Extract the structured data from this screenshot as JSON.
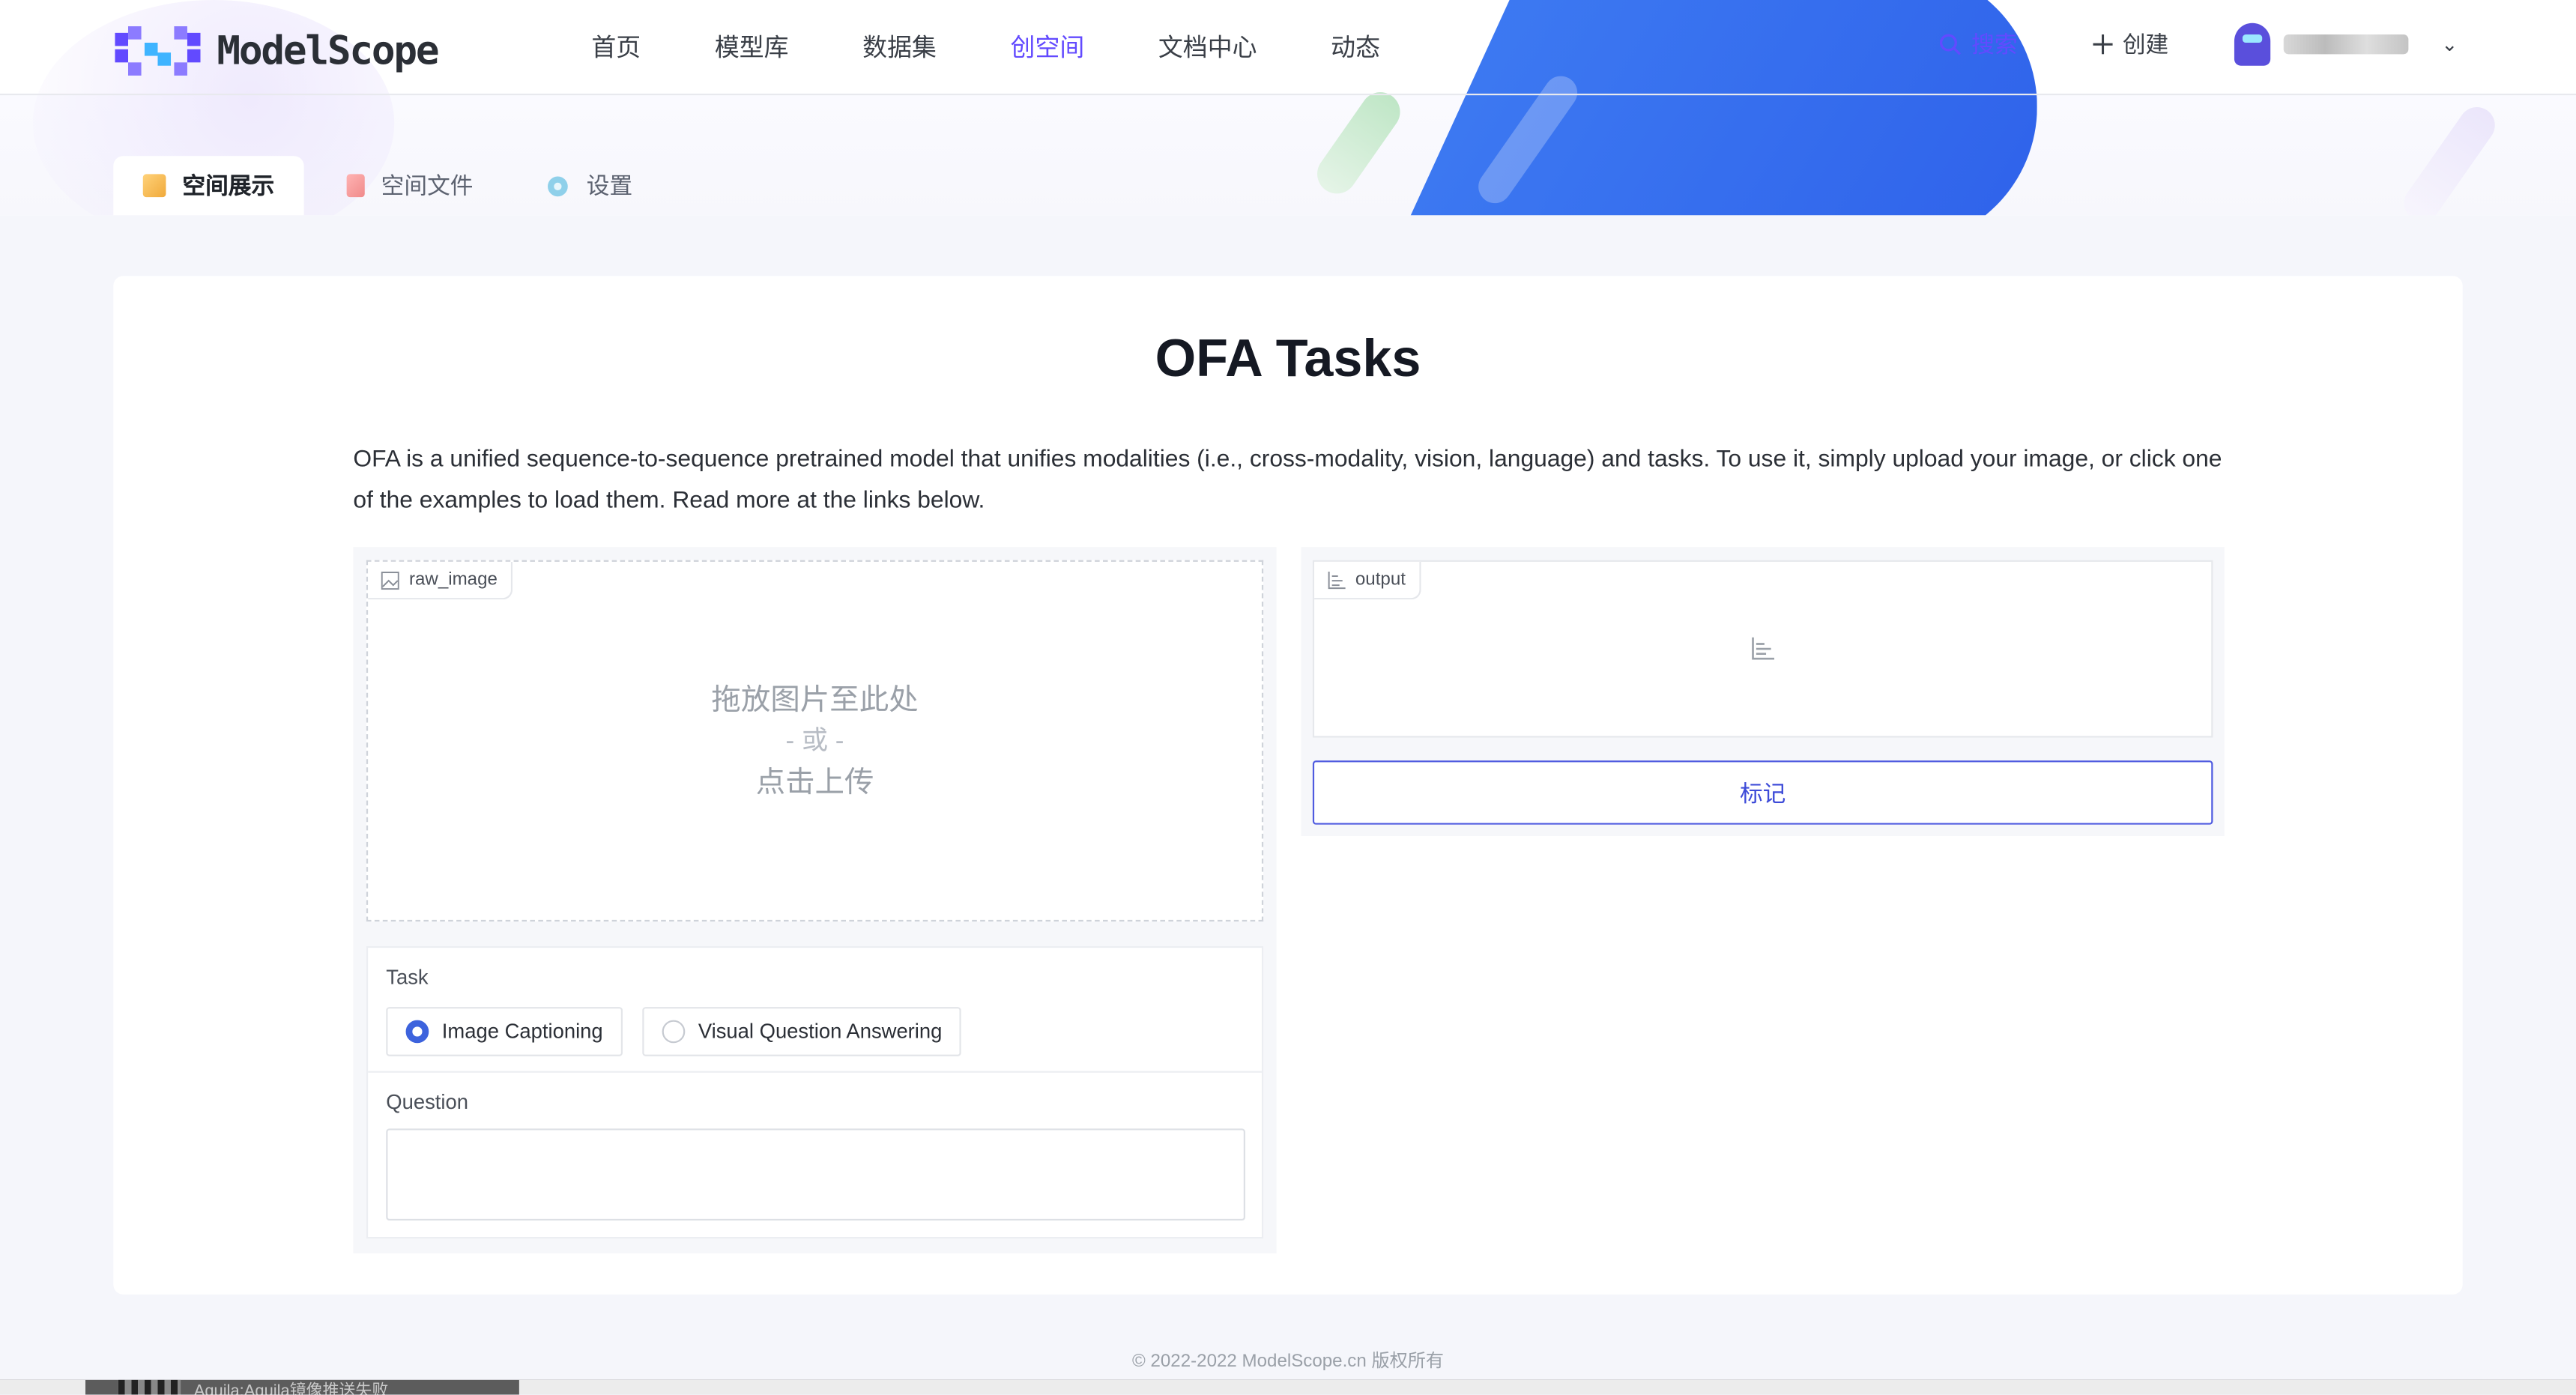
{
  "brand": {
    "name": "ModelScope",
    "accent": "#624aff"
  },
  "nav": {
    "items": [
      {
        "label": "首页"
      },
      {
        "label": "模型库"
      },
      {
        "label": "数据集"
      },
      {
        "label": "创空间",
        "active": true
      },
      {
        "label": "文档中心"
      },
      {
        "label": "动态"
      }
    ]
  },
  "toolbar": {
    "search_label": "搜索",
    "create_label": "创建"
  },
  "tabs": [
    {
      "label": "空间展示",
      "active": true,
      "icon": "box-icon"
    },
    {
      "label": "空间文件",
      "icon": "book-icon"
    },
    {
      "label": "设置",
      "icon": "gear-icon"
    }
  ],
  "main": {
    "title": "OFA Tasks",
    "description": "OFA is a unified sequence-to-sequence pretrained model that unifies modalities (i.e., cross-modality, vision, language) and tasks. To use it, simply upload your image, or click one of the examples to load them. Read more at the links below."
  },
  "input_panel": {
    "image_label": "raw_image",
    "upload_line1": "拖放图片至此处",
    "upload_or": "- 或 -",
    "upload_line2": "点击上传",
    "task_label": "Task",
    "task_options": [
      {
        "label": "Image Captioning",
        "selected": true
      },
      {
        "label": "Visual Question Answering",
        "selected": false
      }
    ],
    "question_label": "Question",
    "question_value": ""
  },
  "output_panel": {
    "label": "output",
    "flag_button": "标记"
  },
  "footer": {
    "text": "© 2022-2022 ModelScope.cn 版权所有"
  },
  "taskbar": {
    "text": "Aquila:Aquila镜像推送失败"
  }
}
